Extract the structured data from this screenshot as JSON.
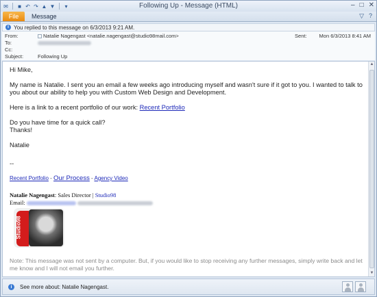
{
  "window": {
    "title": "Following Up  -  Message (HTML)",
    "controls": [
      "–",
      "□",
      "✕"
    ]
  },
  "quick_access": {
    "icons": [
      "outlook-icon",
      "save-icon",
      "undo-icon",
      "redo-icon",
      "up-arrow-icon",
      "down-arrow-icon",
      "customize-icon"
    ]
  },
  "ribbon": {
    "file_tab": "File",
    "message_tab": "Message",
    "right_icons": [
      "minimize-ribbon-icon",
      "help-icon"
    ]
  },
  "infobar": {
    "text": "You replied to this message on 6/3/2013 9:21 AM."
  },
  "header": {
    "from_label": "From:",
    "from_value": "Natalie Nagengast <natalie.nagengast@studio98mail.com>",
    "to_label": "To:",
    "cc_label": "Cc:",
    "subject_label": "Subject:",
    "subject_value": "Following Up",
    "sent_label": "Sent:",
    "sent_value": "Mon 6/3/2013 8:41 AM"
  },
  "body": {
    "greeting": "Hi Mike,",
    "para1": "My name is Natalie. I sent you an email a few weeks ago introducing myself and wasn't sure if it got to you. I wanted to talk to you about our ability to help you with Custom Web Design and Development.",
    "para2_prefix": "Here is a link to a recent portfolio of our work: ",
    "para2_link": "Recent Portfolio",
    "para3_line1": "Do you have time for a quick call?",
    "para3_line2": "Thanks!",
    "signoff": "Natalie",
    "dashes": "--",
    "link_portfolio": "Recent Portfolio",
    "link_sep1": " - ",
    "link_process": "Our Process",
    "link_sep2": " - ",
    "link_video": "Agency Video",
    "sig_name": "Natalie Nagengast",
    "sig_title": ": Sales Director | ",
    "sig_company": "Studio98",
    "sig_email_label": "Email: ",
    "logo_text": "Studio98",
    "note": "Note: This message was not sent by a computer. But, if you would like to stop receiving any further messages, simply write back and let me know and I will not email you further."
  },
  "people_pane": {
    "text": "See more about: Natalie Nagengast."
  }
}
